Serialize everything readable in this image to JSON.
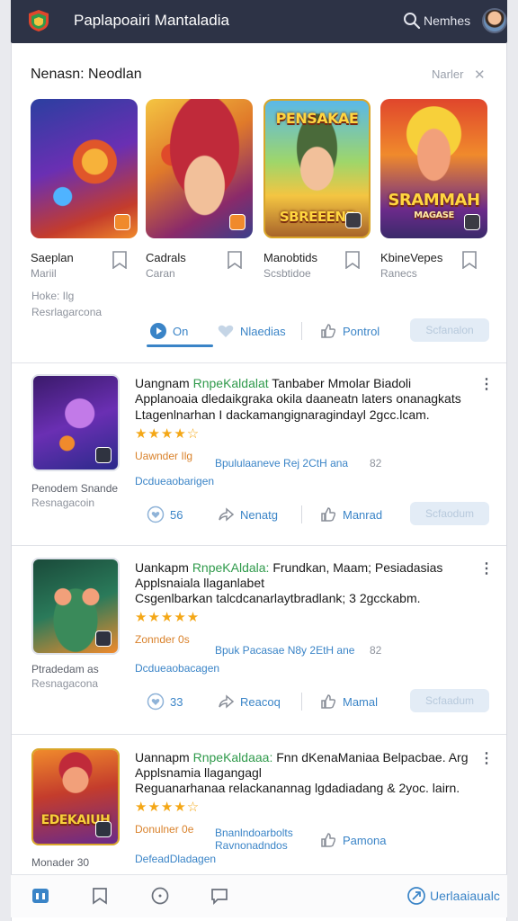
{
  "header": {
    "app_title": "Paplapoairi Mantaladia",
    "search_label": "Nemhes"
  },
  "featured": {
    "title": "Nenasn: Neodlan",
    "more_label": "Narler",
    "close_glyph": "✕",
    "cards": [
      {
        "name": "Saeplan",
        "sub": "Mariil",
        "art": ""
      },
      {
        "name": "Cadrals",
        "sub": "Caran",
        "art": ""
      },
      {
        "name": "Manobtids",
        "sub": "Scsbtidoe",
        "art_top": "PENSAKAE",
        "art_bottom": "SBREEENE"
      },
      {
        "name": "KbineVepes",
        "sub": "Ranecs",
        "art_top": "SRAMMAH",
        "art_bottom": "MAGASE"
      }
    ],
    "meta1": "Hoke: Ilg",
    "meta2": "Resrlagarcona",
    "actions": {
      "a1": "On",
      "a2": "Nlaedias",
      "a3": "Pontrol",
      "button": "Scfanalon"
    }
  },
  "apps": [
    {
      "title_prefix": "Uangnam",
      "title_highlight": "RnpeKaldalat",
      "title_rest": "Tanbaber Mmolar Biadoli",
      "line2": "Applanoaia dledaikgraka okila daaneatn laters onanagkats",
      "line3": "Ltagenlnarhan I dackamangignaragindayl 2gcc.lcam.",
      "stars": "★★★★☆",
      "orange": "Uawnder Ilg",
      "blue": "Bpululaaneve Rej 2CtH ana",
      "num": "82",
      "link": "Dcdueaobarigen",
      "cap1": "Penodem Snande",
      "cap2": "Resnagacoin",
      "actions": {
        "a1": "56",
        "a2": "Nenatg",
        "a3": "Manrad",
        "button": "Scfaodum"
      }
    },
    {
      "title_prefix": "Uankapm",
      "title_highlight": "RnpeKAldala:",
      "title_rest": "Frundkan, Maam; Pesiadasias",
      "line2": "Applsnaiala llaganlabet",
      "line3": "Csgenlbarkan talcdcanarlaytbradlank; 3 2gcckabm.",
      "stars": "★★★★★",
      "orange": "Zonnder 0s",
      "blue": "Bpuk Pacasae N8y 2EtH ane",
      "num": "82",
      "link": "Dcdueaobacagen",
      "cap1": "Ptradedam as",
      "cap2": "Resnagacona",
      "actions": {
        "a1": "33",
        "a2": "Reacoq",
        "a3": "Mamal",
        "button": "Scfaadum"
      }
    },
    {
      "title_prefix": "Uannapm",
      "title_highlight": "RnpeKaldaaa:",
      "title_rest": "Fnn dKenaManiaa Belpacbae. Arg",
      "line2": "Applsnamia llagangagl",
      "line3": "Reguanarhanaa relackanannag lgdadiadang & 2yoc. lairn.",
      "stars": "★★★★☆",
      "orange": "Donulner 0e",
      "blue": "Bnanlndoarbolts",
      "blue2": "Ravnonadndos",
      "num": "82",
      "link": "DefeadDladagen",
      "cap1": "Monader 30",
      "cap2": "",
      "actions": {
        "a3": "Pamona"
      },
      "art_word": "EDEKAIUH"
    }
  ],
  "bottom_nav": {
    "label": "Uerlaaiaualc"
  },
  "colors": {
    "topbar": "#2d3346",
    "accent_blue": "#3a84c7",
    "highlight_green": "#2f9a4b",
    "star": "#f4a716",
    "orange": "#d9812a"
  }
}
